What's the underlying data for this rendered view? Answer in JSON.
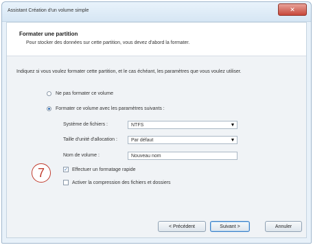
{
  "window": {
    "title": "Assistant Création d'un volume simple"
  },
  "header": {
    "title": "Formater une partition",
    "subtitle": "Pour stocker des données sur cette partition, vous devez d'abord la formater."
  },
  "intro": "Indiquez si vous voulez formater cette partition, et le cas échéant, les paramètres que vous voulez utiliser.",
  "options": {
    "no_format": "Ne pas formater ce volume",
    "format_with": "Formater ce volume avec les paramètres suivants :"
  },
  "fields": {
    "filesystem_label": "Système de fichiers :",
    "filesystem_value": "NTFS",
    "alloc_label": "Taille d'unité d'allocation :",
    "alloc_value": "Par défaut",
    "volume_label": "Nom de volume :",
    "volume_value": "Nouveau nom"
  },
  "checks": {
    "quick_format": "Effectuer un formatage rapide",
    "compression": "Activer la compression des fichiers et dossiers"
  },
  "callout_number": "7",
  "buttons": {
    "back": "< Précédent",
    "next": "Suivant >",
    "cancel": "Annuler"
  }
}
